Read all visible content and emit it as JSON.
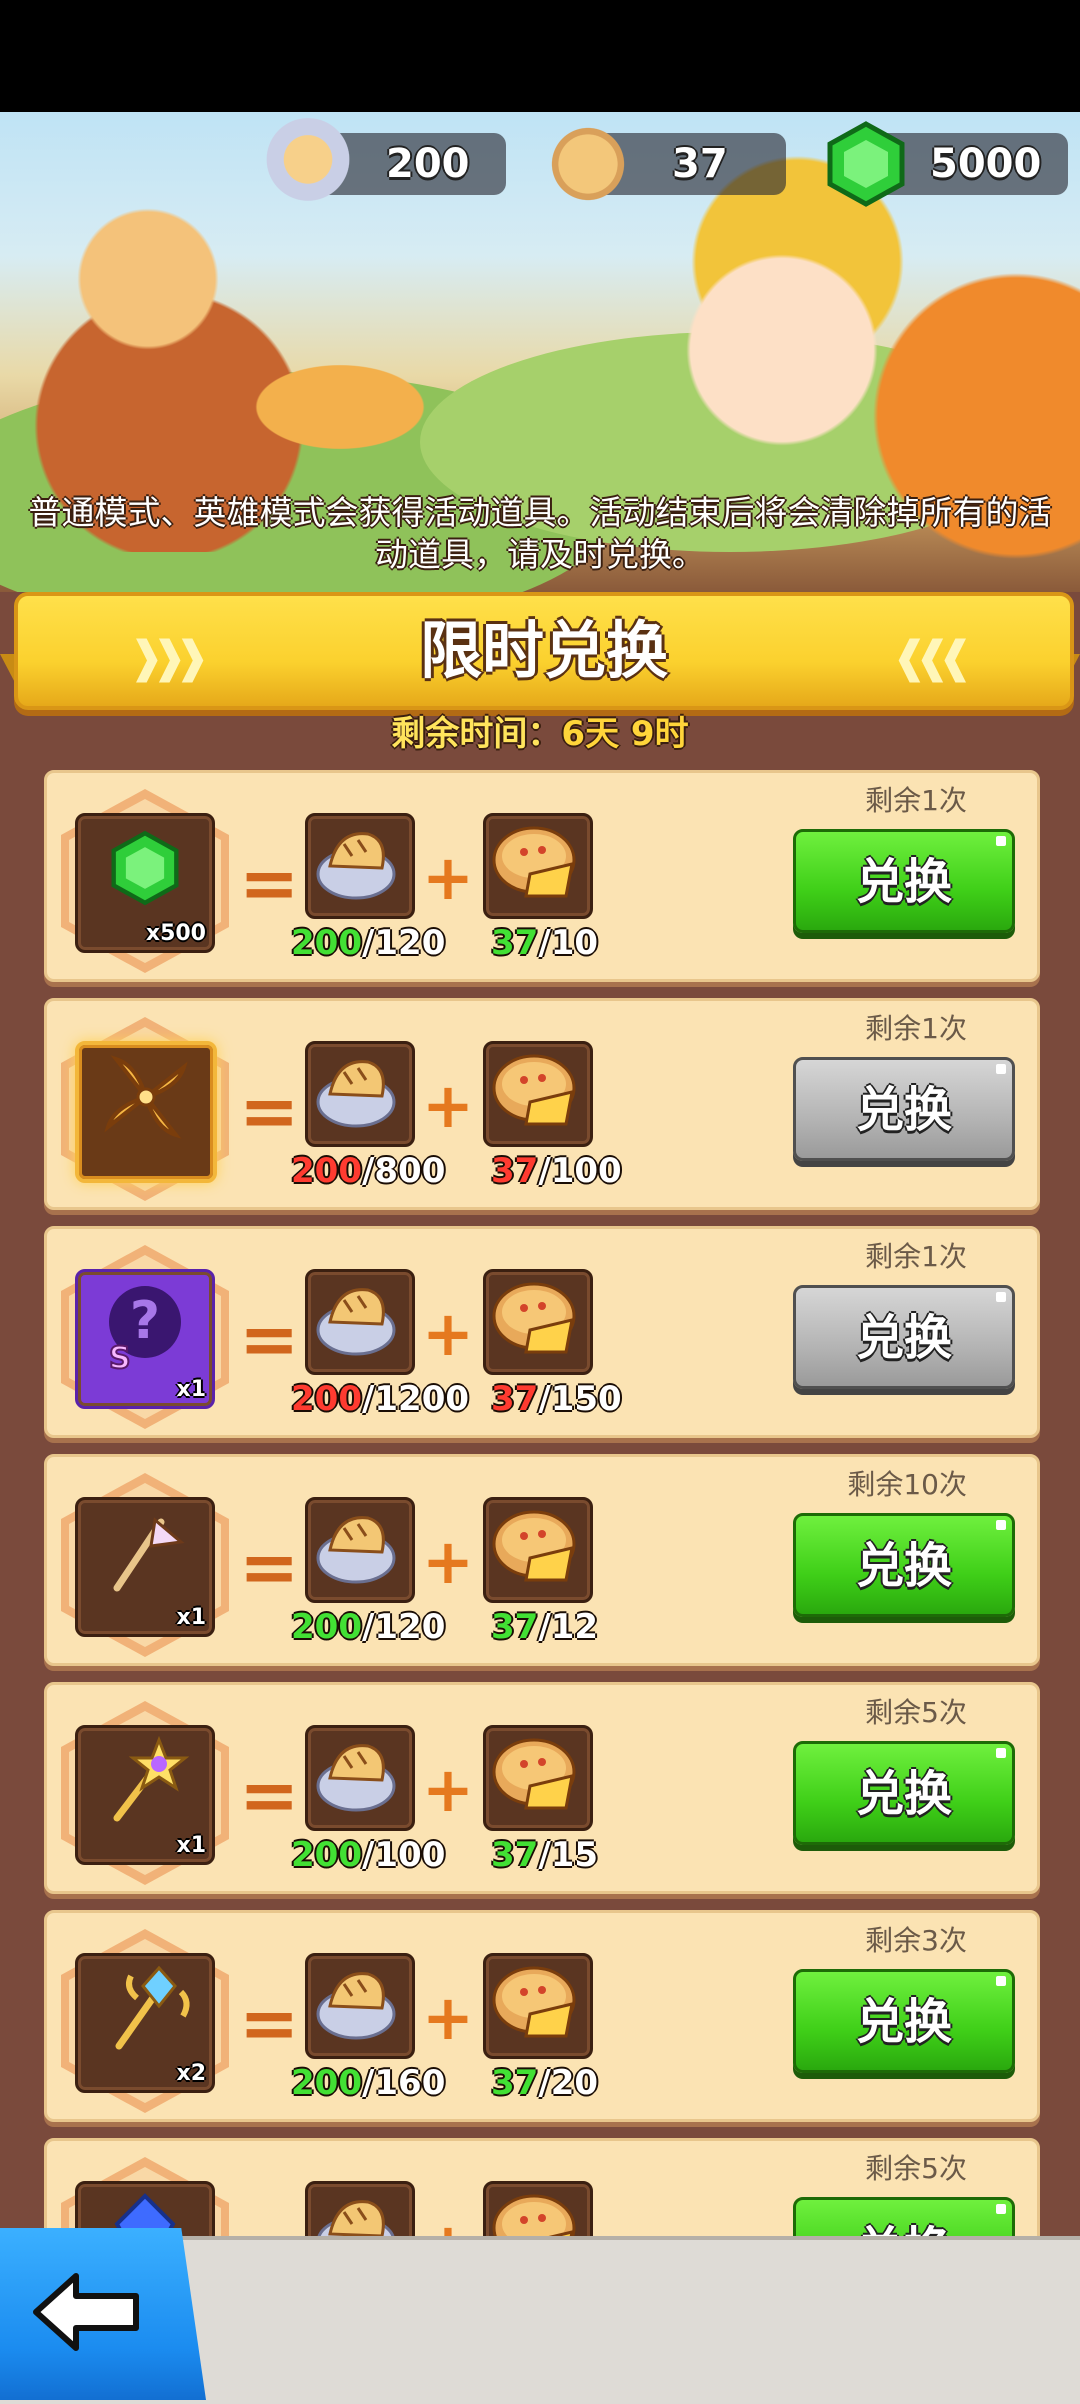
{
  "currencies": [
    {
      "icon": "bread-icon",
      "value": "200"
    },
    {
      "icon": "pie-icon",
      "value": "37"
    },
    {
      "icon": "gem-icon",
      "value": "5000"
    }
  ],
  "notice": "普通模式、英雄模式会获得活动道具。活动结束后将会清除掉所有的活动道具，请及时兑换。",
  "title": "限时兑换",
  "remaining_label": "剩余时间：",
  "remaining_value": "6天 9时",
  "rows": [
    {
      "item": "gem-icon",
      "qty": "x500",
      "bread_have": "200",
      "bread_need": "/120",
      "bread_ok": true,
      "pie_have": "37",
      "pie_need": "/10",
      "pie_ok": true,
      "left": "剩余1次",
      "button": "兑换",
      "enabled": true
    },
    {
      "item": "shuriken-icon",
      "qty": "",
      "bread_have": "200",
      "bread_need": "/800",
      "bread_ok": false,
      "pie_have": "37",
      "pie_need": "/100",
      "pie_ok": false,
      "left": "剩余1次",
      "button": "兑换",
      "enabled": false
    },
    {
      "item": "mystery-hero-icon",
      "qty": "x1",
      "bread_have": "200",
      "bread_need": "/1200",
      "bread_ok": false,
      "pie_have": "37",
      "pie_need": "/150",
      "pie_ok": false,
      "left": "剩余1次",
      "button": "兑换",
      "enabled": false
    },
    {
      "item": "flag-wand-icon",
      "qty": "x1",
      "bread_have": "200",
      "bread_need": "/120",
      "bread_ok": true,
      "pie_have": "37",
      "pie_need": "/12",
      "pie_ok": true,
      "left": "剩余10次",
      "button": "兑换",
      "enabled": true
    },
    {
      "item": "star-staff-icon",
      "qty": "x1",
      "bread_have": "200",
      "bread_need": "/100",
      "bread_ok": true,
      "pie_have": "37",
      "pie_need": "/15",
      "pie_ok": true,
      "left": "剩余5次",
      "button": "兑换",
      "enabled": true
    },
    {
      "item": "crystal-scepter-icon",
      "qty": "x2",
      "bread_have": "200",
      "bread_need": "/160",
      "bread_ok": true,
      "pie_have": "37",
      "pie_need": "/20",
      "pie_ok": true,
      "left": "剩余3次",
      "button": "兑换",
      "enabled": true
    },
    {
      "item": "blue-crystal-icon",
      "qty": "",
      "left": "剩余5次",
      "button": "兑换",
      "enabled": true
    }
  ],
  "colors": {
    "accent_green": "#3fcf18",
    "disabled_gray": "#b4b4b4",
    "ok_text": "#42e034",
    "bad_text": "#ff3b30",
    "ribbon_yellow": "#fbd12e"
  }
}
